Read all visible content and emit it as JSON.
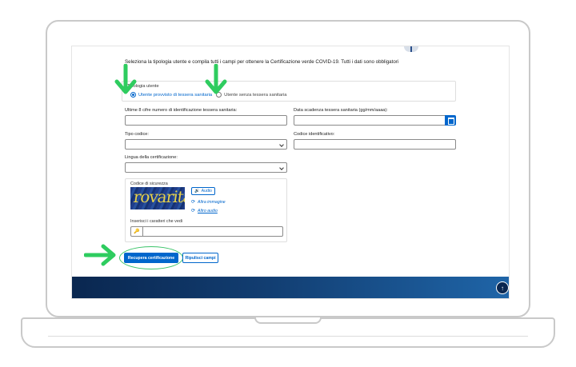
{
  "intro_text": "Seleziona la tipologia utente e compila tutti i campi per ottenere la Certificazione verde COVID-19. Tutti i dati sono obbligatori",
  "user_type": {
    "legend": "Tipologia utente",
    "options": [
      {
        "label": "Utente provvisto di tessera sanitaria",
        "selected": true
      },
      {
        "label": "Utente senza tessera sanitaria",
        "selected": false
      }
    ]
  },
  "fields": {
    "health_card_label": "Ultime 8 cifre numero di identificazione tessera sanitaria:",
    "health_card_value": "",
    "expiry_label": "Data scadenza tessera sanitaria (gg/mm/aaaa):",
    "expiry_value": "",
    "code_type_label": "Tipo codice:",
    "code_type_value": "",
    "code_id_label": "Codice identificativo:",
    "code_id_value": "",
    "language_label": "Lingua della certificazione:",
    "language_value": ""
  },
  "captcha": {
    "title": "Codice di sicurezza",
    "image_text": "rovarita",
    "audio_label": "Audio",
    "other_image_label": "Altra immagine",
    "other_audio_label": "Altro audio",
    "input_label": "Inserisci i caratteri che vedi",
    "input_value": ""
  },
  "buttons": {
    "submit": "Recupera certificazione",
    "reset": "Ripulisci campi"
  },
  "colors": {
    "primary": "#0066cc",
    "annotation_arrow": "#2ecc5f",
    "footer": "#0a2750"
  },
  "icons": {
    "calendar": "calendar-icon",
    "audio": "speaker-icon",
    "refresh": "refresh-icon",
    "key": "key-icon",
    "back_to_top": "arrow-up-icon"
  }
}
